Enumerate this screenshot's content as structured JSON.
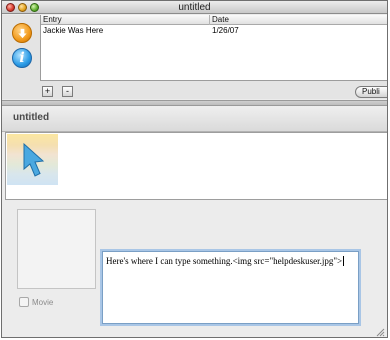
{
  "window": {
    "title": "untitled"
  },
  "toolbar": {
    "download_icon": "download-arrow-icon",
    "info_icon": "info-icon",
    "info_glyph": "i"
  },
  "entries_table": {
    "columns": [
      "Entry",
      "Date"
    ],
    "rows": [
      {
        "entry": "Jackie Was Here",
        "date": "1/26/07"
      }
    ]
  },
  "list_controls": {
    "add_label": "+",
    "remove_label": "-",
    "publish_label": "Publi"
  },
  "entry_header": {
    "title": "untitled"
  },
  "media": {
    "thumbnail_icon": "cursor-arrow-icon",
    "movie_label": "Movie",
    "movie_checked": false
  },
  "editor": {
    "text": "Here's where I can type something.<img src=\"helpdeskuser.jpg\">"
  },
  "colors": {
    "accent_focus": "#a9c6e6",
    "close": "#d83a2c",
    "minimize": "#e3a31d",
    "zoom": "#5fae2e",
    "download_orange": "#f29a1b",
    "info_blue": "#2a9be6"
  }
}
